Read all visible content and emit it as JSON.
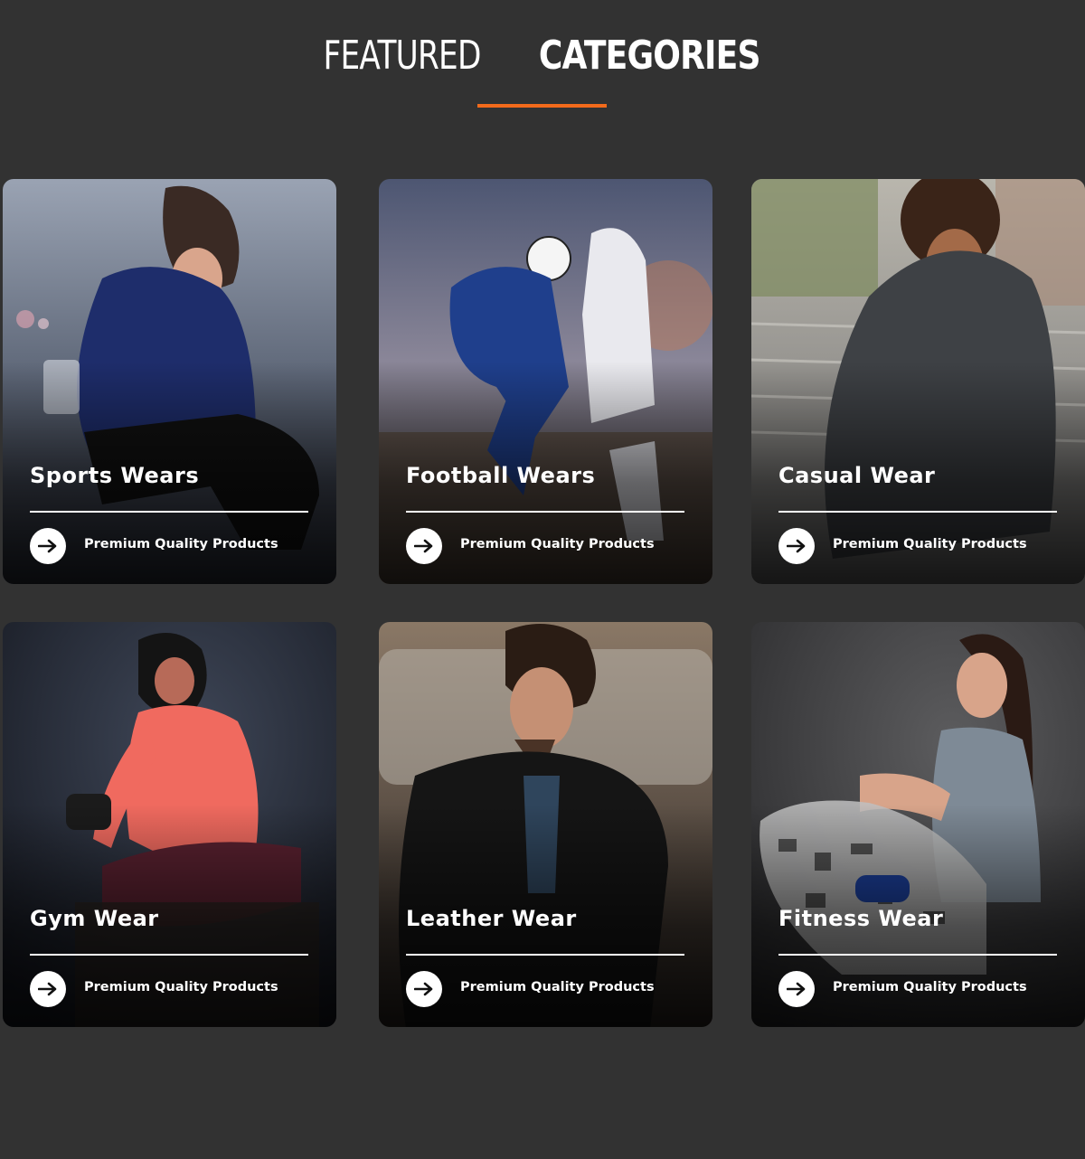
{
  "section": {
    "heading_light": "FEATURED",
    "heading_bold": "CATEGORIES",
    "accent_color": "#f26a1b"
  },
  "categories": [
    {
      "title": "Sports Wears",
      "subtitle": "Premium Quality Products",
      "icon": "arrow-right-icon"
    },
    {
      "title": "Football Wears",
      "subtitle": "Premium Quality Products",
      "icon": "arrow-right-icon"
    },
    {
      "title": "Casual Wear",
      "subtitle": "Premium Quality Products",
      "icon": "arrow-right-icon"
    },
    {
      "title": "Gym Wear",
      "subtitle": "Premium Quality Products",
      "icon": "arrow-right-icon"
    },
    {
      "title": "Leather Wear",
      "subtitle": "Premium Quality Products",
      "icon": "arrow-right-icon"
    },
    {
      "title": "Fitness Wear",
      "subtitle": "Premium Quality Products",
      "icon": "arrow-right-icon"
    }
  ]
}
